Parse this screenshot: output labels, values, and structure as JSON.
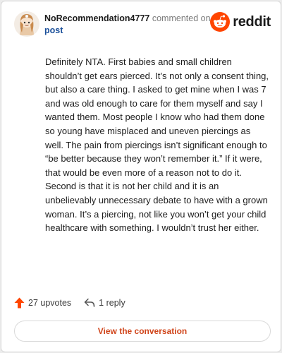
{
  "header": {
    "username": "NoRecommendation4777",
    "commented_on": "commented on",
    "post_link": "post",
    "brand_name": "reddit",
    "brand_color": "#ff4500",
    "avatar_icon": "snoo-avatar-icon"
  },
  "comment": {
    "text": "Definitely NTA. First babies and small children shouldn’t get ears pierced. It’s not only a consent thing, but also a care thing. I asked to get mine when I was 7 and was old enough to care for them myself and say I wanted them. Most people I know who had them done so young have misplaced and uneven piercings as well. The pain from piercings isn’t significant enough to “be better because they won’t remember it.” If it were, that would be even more of a reason not to do it. Second is that it is not her child and it is an unbelievably unnecessary debate to have with a grown woman. It’s a piercing, not like you won’t get your child healthcare with something. I wouldn’t trust her either."
  },
  "actions": {
    "upvotes_label": "27 upvotes",
    "upvote_icon": "upvote-arrow-icon",
    "upvote_color": "#ff4500",
    "reply_label": "1 reply",
    "reply_icon": "reply-icon"
  },
  "cta": {
    "label": "View the conversation",
    "color": "#d0451b"
  }
}
